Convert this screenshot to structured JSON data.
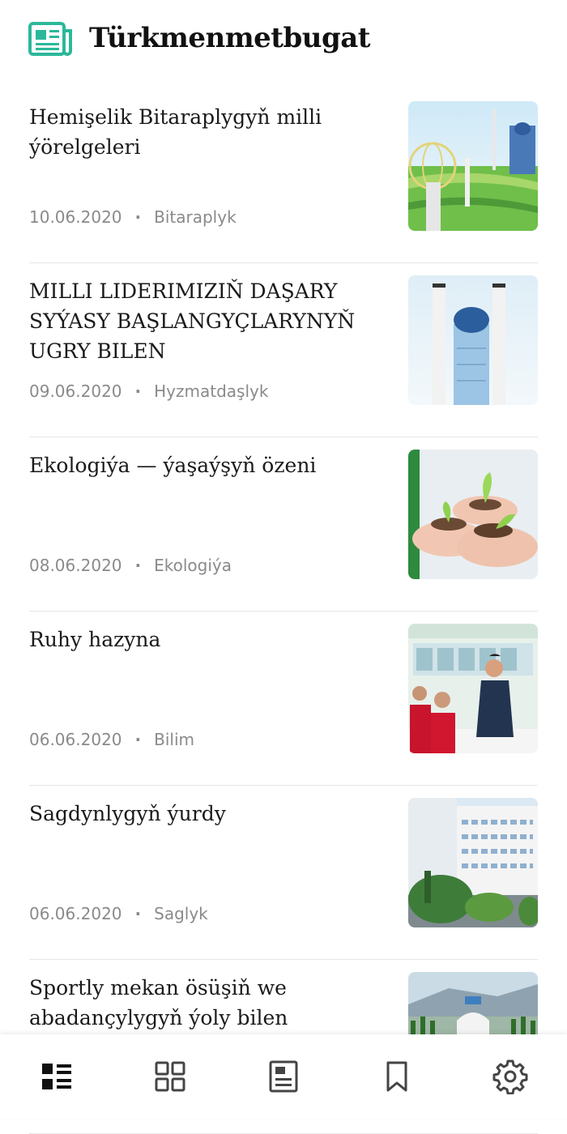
{
  "header": {
    "title": "Türkmenmetbugat",
    "logo_icon": "newspaper-icon",
    "accent_color": "#2bb89a"
  },
  "articles": [
    {
      "title": "Hemişelik Bitaraplygyň milli ýörelgeleri",
      "date": "10.06.2020",
      "category": "Bitaraplyk",
      "thumb": "city-monument"
    },
    {
      "title": "MILLI LIDERIMIZIŇ DAŞARY SYÝASY BAŞLANGYÇLARYNYŇ UGRY BILEN",
      "date": "09.06.2020",
      "category": "Hyzmatdaşlyk",
      "thumb": "skyscraper"
    },
    {
      "title": "Ekologiýa — ýaşaýşyň özeni",
      "date": "08.06.2020",
      "category": "Ekologiýa",
      "thumb": "seedlings-in-hands"
    },
    {
      "title": "Ruhy hazyna",
      "date": "06.06.2020",
      "category": "Bilim",
      "thumb": "book-exhibition"
    },
    {
      "title": "Sagdynlygyň ýurdy",
      "date": "06.06.2020",
      "category": "Saglyk",
      "thumb": "health-resort"
    },
    {
      "title": "Sportly mekan ösüşiň we abadançylygyň ýoly bilen",
      "date": "",
      "category": "",
      "thumb": "sports-complex"
    }
  ],
  "bottom_nav": {
    "items": [
      {
        "icon": "list-view-icon",
        "active": true
      },
      {
        "icon": "grid-view-icon",
        "active": false
      },
      {
        "icon": "newspaper-icon",
        "active": false
      },
      {
        "icon": "bookmark-icon",
        "active": false
      },
      {
        "icon": "settings-gear-icon",
        "active": false
      }
    ]
  }
}
